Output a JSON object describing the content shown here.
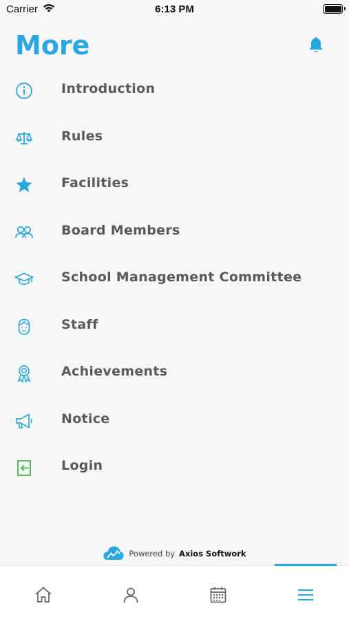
{
  "status": {
    "carrier": "Carrier",
    "time": "6:13 PM"
  },
  "header": {
    "title": "More"
  },
  "menu": [
    {
      "label": "Introduction",
      "icon": "info-icon"
    },
    {
      "label": "Rules",
      "icon": "scales-icon"
    },
    {
      "label": "Facilities",
      "icon": "star-icon"
    },
    {
      "label": "Board Members",
      "icon": "people-icon"
    },
    {
      "label": "School Management Committee",
      "icon": "graduation-cap-icon"
    },
    {
      "label": "Staff",
      "icon": "person-face-icon"
    },
    {
      "label": "Achievements",
      "icon": "award-ribbon-icon"
    },
    {
      "label": "Notice",
      "icon": "megaphone-icon"
    },
    {
      "label": "Login",
      "icon": "login-icon"
    }
  ],
  "footer": {
    "powered_by": "Powered by",
    "brand": "Axios Softwork"
  },
  "tabs": [
    {
      "icon": "home-icon",
      "active": false
    },
    {
      "icon": "profile-icon",
      "active": false
    },
    {
      "icon": "calendar-icon",
      "active": false
    },
    {
      "icon": "hamburger-menu-icon",
      "active": true
    }
  ],
  "colors": {
    "accent": "#2aa6e0",
    "login": "#4caf50",
    "text": "#5a5a5a"
  }
}
